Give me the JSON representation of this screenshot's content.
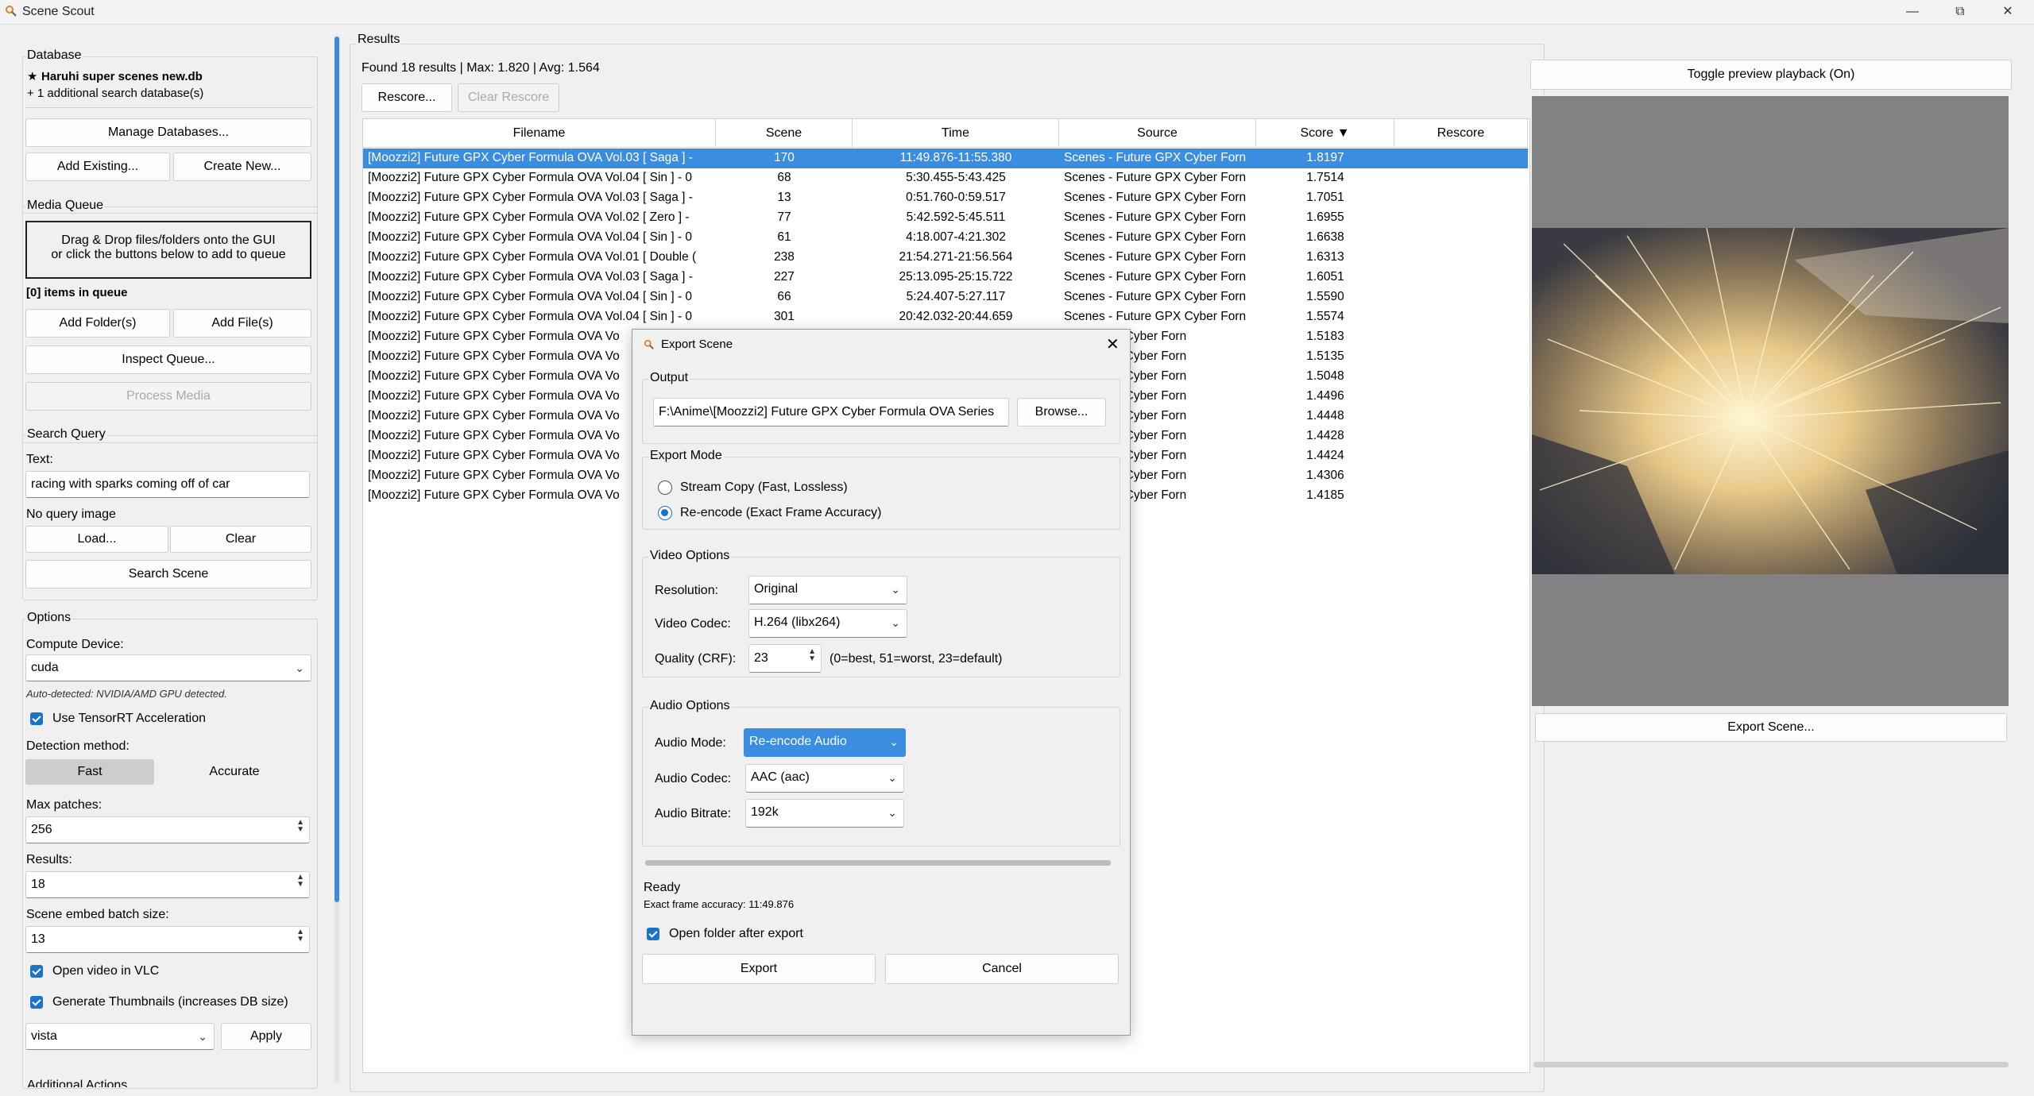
{
  "window": {
    "title": "Scene Scout"
  },
  "database": {
    "title": "Database",
    "name": "Haruhi super scenes new.db",
    "additional": "+ 1 additional search database(s)",
    "manage": "Manage Databases...",
    "add_existing": "Add Existing...",
    "create_new": "Create New..."
  },
  "media_queue": {
    "title": "Media Queue",
    "drop_line1": "Drag & Drop files/folders onto the GUI",
    "drop_line2": "or click the buttons below to add to queue",
    "count": "[0] items in queue",
    "add_folders": "Add Folder(s)",
    "add_files": "Add File(s)",
    "inspect": "Inspect Queue...",
    "process": "Process Media"
  },
  "search": {
    "title": "Search Query",
    "text_label": "Text:",
    "text_value": "racing with sparks coming off of car",
    "no_image": "No query image",
    "load": "Load...",
    "clear": "Clear",
    "search_scene": "Search Scene"
  },
  "options": {
    "title": "Options",
    "compute_label": "Compute Device:",
    "compute_value": "cuda",
    "auto_detect": "Auto-detected: NVIDIA/AMD GPU detected.",
    "tensorrt": "Use TensorRT Acceleration",
    "detection_label": "Detection method:",
    "fast": "Fast",
    "accurate": "Accurate",
    "max_patches_label": "Max patches:",
    "max_patches": "256",
    "results_label": "Results:",
    "results": "18",
    "batch_label": "Scene embed batch size:",
    "batch": "13",
    "vlc": "Open video in VLC",
    "thumbs": "Generate Thumbnails (increases DB size)",
    "theme": "vista",
    "apply": "Apply",
    "additional_actions": "Additional Actions"
  },
  "results": {
    "title": "Results",
    "summary": "Found 18 results | Max: 1.820 | Avg: 1.564",
    "rescore": "Rescore...",
    "clear_rescore": "Clear Rescore",
    "columns": [
      "Filename",
      "Scene",
      "Time",
      "Source",
      "Score ▼",
      "Rescore"
    ],
    "rows": [
      {
        "file": "[Moozzi2] Future GPX Cyber Formula OVA Vol.03 [ Saga ] -",
        "scene": "170",
        "time": "11:49.876-11:55.380",
        "source": "Scenes - Future GPX Cyber Forn",
        "score": "1.8197"
      },
      {
        "file": "[Moozzi2] Future GPX Cyber Formula OVA Vol.04 [ Sin ] - 0",
        "scene": "68",
        "time": "5:30.455-5:43.425",
        "source": "Scenes - Future GPX Cyber Forn",
        "score": "1.7514"
      },
      {
        "file": "[Moozzi2] Future GPX Cyber Formula OVA Vol.03 [ Saga ] -",
        "scene": "13",
        "time": "0:51.760-0:59.517",
        "source": "Scenes - Future GPX Cyber Forn",
        "score": "1.7051"
      },
      {
        "file": "[Moozzi2] Future GPX Cyber Formula OVA Vol.02 [ Zero ] -",
        "scene": "77",
        "time": "5:42.592-5:45.511",
        "source": "Scenes - Future GPX Cyber Forn",
        "score": "1.6955"
      },
      {
        "file": "[Moozzi2] Future GPX Cyber Formula OVA Vol.04 [ Sin ] - 0",
        "scene": "61",
        "time": "4:18.007-4:21.302",
        "source": "Scenes - Future GPX Cyber Forn",
        "score": "1.6638"
      },
      {
        "file": "[Moozzi2] Future GPX Cyber Formula OVA Vol.01 [ Double (",
        "scene": "238",
        "time": "21:54.271-21:56.564",
        "source": "Scenes - Future GPX Cyber Forn",
        "score": "1.6313"
      },
      {
        "file": "[Moozzi2] Future GPX Cyber Formula OVA Vol.03 [ Saga ] -",
        "scene": "227",
        "time": "25:13.095-25:15.722",
        "source": "Scenes - Future GPX Cyber Forn",
        "score": "1.6051"
      },
      {
        "file": "[Moozzi2] Future GPX Cyber Formula OVA Vol.04 [ Sin ] - 0",
        "scene": "66",
        "time": "5:24.407-5:27.117",
        "source": "Scenes - Future GPX Cyber Forn",
        "score": "1.5590"
      },
      {
        "file": "[Moozzi2] Future GPX Cyber Formula OVA Vol.04 [ Sin ] - 0",
        "scene": "301",
        "time": "20:42.032-20:44.659",
        "source": "Scenes - Future GPX Cyber Forn",
        "score": "1.5574"
      },
      {
        "file": "[Moozzi2] Future GPX Cyber Formula OVA Vo",
        "scene": "",
        "time": "",
        "source": "uture GPX Cyber Forn",
        "score": "1.5183"
      },
      {
        "file": "[Moozzi2] Future GPX Cyber Formula OVA Vo",
        "scene": "",
        "time": "",
        "source": "uture GPX Cyber Forn",
        "score": "1.5135"
      },
      {
        "file": "[Moozzi2] Future GPX Cyber Formula OVA Vo",
        "scene": "",
        "time": "",
        "source": "uture GPX Cyber Forn",
        "score": "1.5048"
      },
      {
        "file": "[Moozzi2] Future GPX Cyber Formula OVA Vo",
        "scene": "",
        "time": "",
        "source": "uture GPX Cyber Forn",
        "score": "1.4496"
      },
      {
        "file": "[Moozzi2] Future GPX Cyber Formula OVA Vo",
        "scene": "",
        "time": "",
        "source": "uture GPX Cyber Forn",
        "score": "1.4448"
      },
      {
        "file": "[Moozzi2] Future GPX Cyber Formula OVA Vo",
        "scene": "",
        "time": "",
        "source": "uture GPX Cyber Forn",
        "score": "1.4428"
      },
      {
        "file": "[Moozzi2] Future GPX Cyber Formula OVA Vo",
        "scene": "",
        "time": "",
        "source": "uture GPX Cyber Forn",
        "score": "1.4424"
      },
      {
        "file": "[Moozzi2] Future GPX Cyber Formula OVA Vo",
        "scene": "",
        "time": "",
        "source": "uture GPX Cyber Forn",
        "score": "1.4306"
      },
      {
        "file": "[Moozzi2] Future GPX Cyber Formula OVA Vo",
        "scene": "",
        "time": "",
        "source": "uture GPX Cyber Forn",
        "score": "1.4185"
      }
    ]
  },
  "preview": {
    "toggle": "Toggle preview playback (On)",
    "export": "Export Scene..."
  },
  "dialog": {
    "title": "Export Scene",
    "output_title": "Output",
    "output_path": "F:\\Anime\\[Moozzi2] Future GPX Cyber Formula OVA Series",
    "browse": "Browse...",
    "mode_title": "Export Mode",
    "stream_copy": "Stream Copy (Fast, Lossless)",
    "reencode": "Re-encode (Exact Frame Accuracy)",
    "video_title": "Video Options",
    "resolution_label": "Resolution:",
    "resolution": "Original",
    "vcodec_label": "Video Codec:",
    "vcodec": "H.264 (libx264)",
    "quality_label": "Quality (CRF):",
    "quality": "23",
    "quality_hint": "(0=best, 51=worst, 23=default)",
    "audio_title": "Audio Options",
    "amode_label": "Audio Mode:",
    "amode": "Re-encode Audio",
    "acodec_label": "Audio Codec:",
    "acodec": "AAC (aac)",
    "abitrate_label": "Audio Bitrate:",
    "abitrate": "192k",
    "status": "Ready",
    "accuracy": "Exact frame accuracy: 11:49.876",
    "open_folder": "Open folder after export",
    "export": "Export",
    "cancel": "Cancel"
  },
  "colors": {
    "accent": "#3a8de0",
    "check": "#1a73c8",
    "preview_bg": "#828282"
  }
}
